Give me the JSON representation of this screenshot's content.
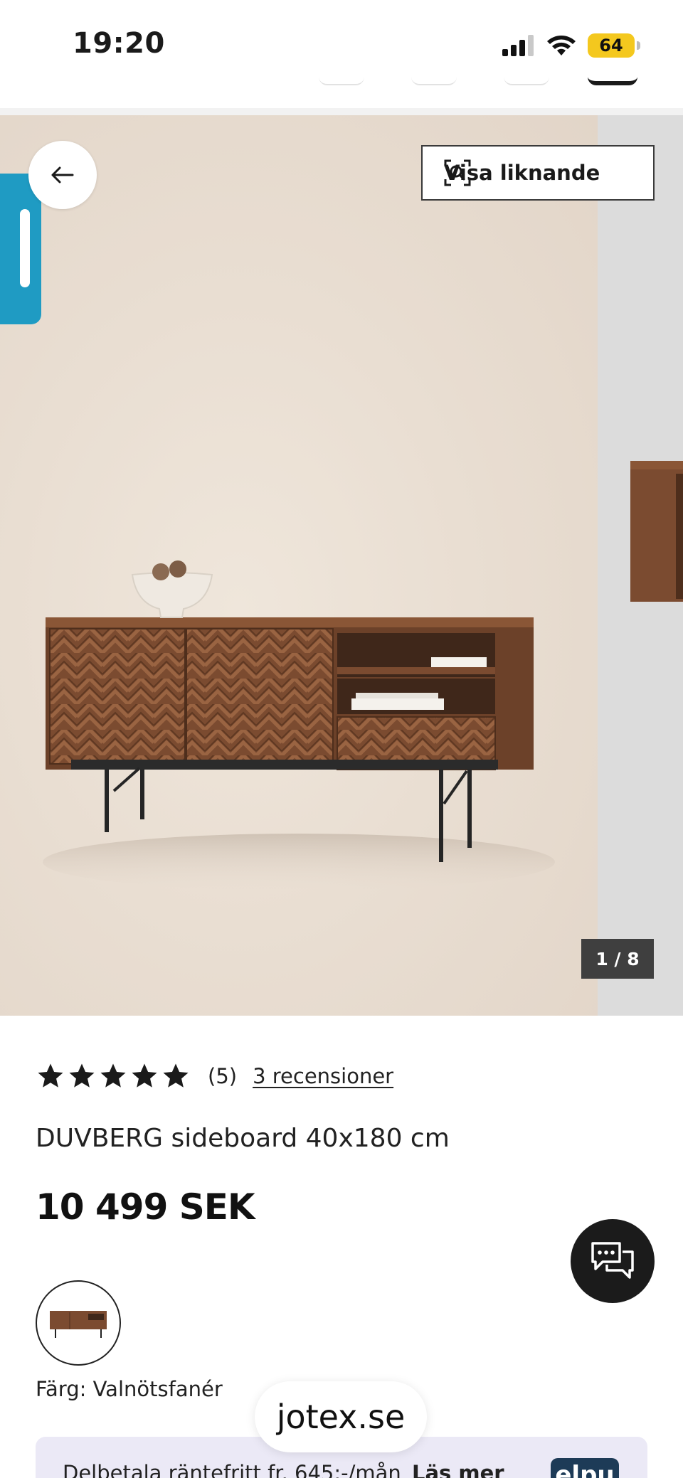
{
  "status_bar": {
    "time": "19:20",
    "battery": "64"
  },
  "gallery": {
    "similar_button_label": "Visa liknande",
    "counter": "1 / 8"
  },
  "product": {
    "rating": {
      "stars": 5,
      "count": "(5)",
      "reviews_link": "3 recensioner"
    },
    "title": "DUVBERG sideboard 40x180 cm",
    "price": "10 499 SEK",
    "color_label": "Färg: Valnötsfanér"
  },
  "footer": {
    "domain": "jotex.se",
    "financing_text": "Delbetala räntefritt fr. 645:-/mån",
    "financing_link": "Läs mer",
    "financing_logo": "elpu"
  },
  "colors": {
    "accent_tab": "#1f9bc3",
    "battery": "#f4c81e",
    "chat_button": "#1b1b1b",
    "banner_bg": "#ebe9f6"
  },
  "icons": {
    "back": "arrow-left-icon",
    "visual_search": "scan-search-icon",
    "chat": "chat-bubbles-icon",
    "star": "star-icon"
  }
}
